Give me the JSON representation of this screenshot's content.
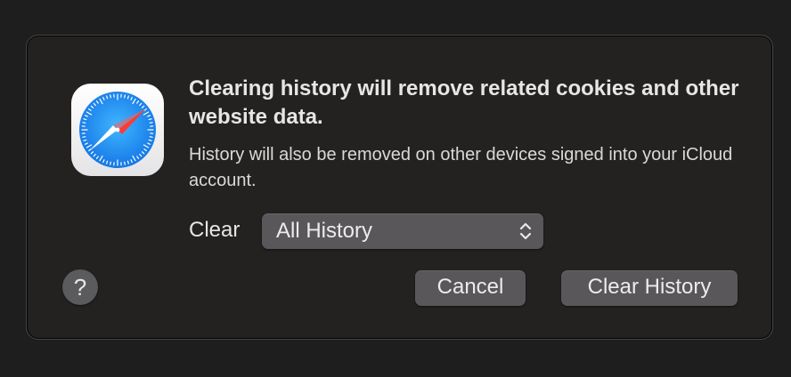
{
  "dialog": {
    "title": "Clearing history will remove related cookies and other website data.",
    "message": "History will also be removed on other devices signed into your iCloud account.",
    "clear_label": "Clear",
    "popup": {
      "selected": "All History"
    },
    "help_label": "?",
    "buttons": {
      "cancel": "Cancel",
      "confirm": "Clear History"
    },
    "app_icon": "safari-compass-icon"
  },
  "colors": {
    "dialog_bg": "#242220",
    "control_bg": "#59575a",
    "text": "#e6e6e6"
  }
}
